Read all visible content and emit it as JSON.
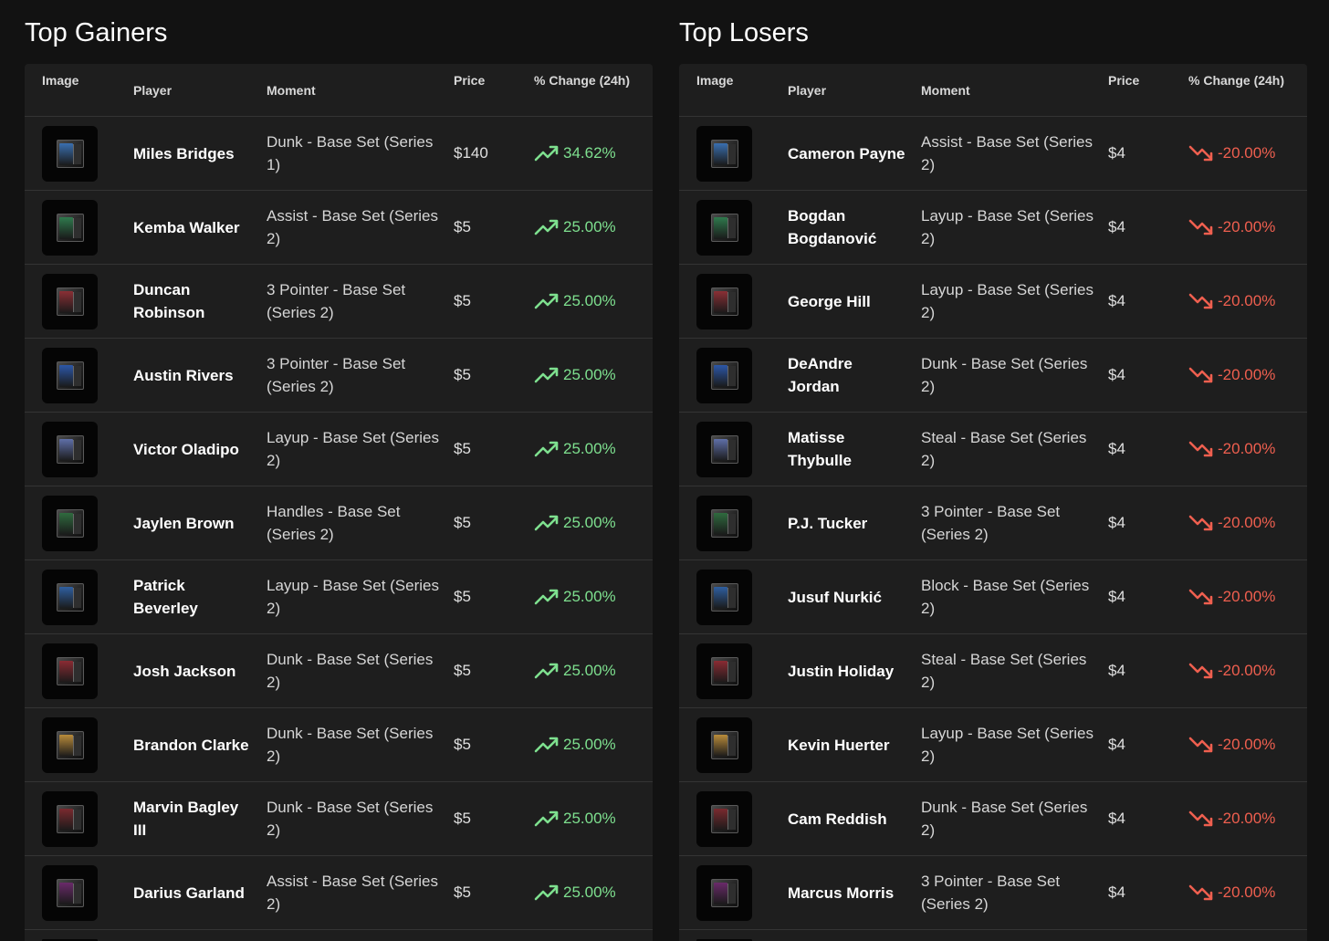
{
  "gainers": {
    "title": "Top Gainers",
    "headers": {
      "image": "Image",
      "player": "Player",
      "moment": "Moment",
      "price": "Price",
      "change": "% Change (24h)"
    },
    "rows": [
      {
        "player": "Miles Bridges",
        "moment": "Dunk - Base Set (Series 1)",
        "price": "$140",
        "change": "34.62%"
      },
      {
        "player": "Kemba Walker",
        "moment": "Assist - Base Set (Series 2)",
        "price": "$5",
        "change": "25.00%"
      },
      {
        "player": "Duncan Robinson",
        "moment": "3 Pointer - Base Set (Series 2)",
        "price": "$5",
        "change": "25.00%"
      },
      {
        "player": "Austin Rivers",
        "moment": "3 Pointer - Base Set (Series 2)",
        "price": "$5",
        "change": "25.00%"
      },
      {
        "player": "Victor Oladipo",
        "moment": "Layup - Base Set (Series 2)",
        "price": "$5",
        "change": "25.00%"
      },
      {
        "player": "Jaylen Brown",
        "moment": "Handles - Base Set (Series 2)",
        "price": "$5",
        "change": "25.00%"
      },
      {
        "player": "Patrick Beverley",
        "moment": "Layup - Base Set (Series 2)",
        "price": "$5",
        "change": "25.00%"
      },
      {
        "player": "Josh Jackson",
        "moment": "Dunk - Base Set (Series 2)",
        "price": "$5",
        "change": "25.00%"
      },
      {
        "player": "Brandon Clarke",
        "moment": "Dunk - Base Set (Series 2)",
        "price": "$5",
        "change": "25.00%"
      },
      {
        "player": "Marvin Bagley III",
        "moment": "Dunk - Base Set (Series 2)",
        "price": "$5",
        "change": "25.00%"
      },
      {
        "player": "Darius Garland",
        "moment": "Assist - Base Set (Series 2)",
        "price": "$5",
        "change": "25.00%"
      }
    ]
  },
  "losers": {
    "title": "Top Losers",
    "headers": {
      "image": "Image",
      "player": "Player",
      "moment": "Moment",
      "price": "Price",
      "change": "% Change (24h)"
    },
    "rows": [
      {
        "player": "Cameron Payne",
        "moment": "Assist - Base Set (Series 2)",
        "price": "$4",
        "change": "-20.00%"
      },
      {
        "player": "Bogdan Bogdanović",
        "moment": "Layup - Base Set (Series 2)",
        "price": "$4",
        "change": "-20.00%"
      },
      {
        "player": "George Hill",
        "moment": "Layup - Base Set (Series 2)",
        "price": "$4",
        "change": "-20.00%"
      },
      {
        "player": "DeAndre Jordan",
        "moment": "Dunk - Base Set (Series 2)",
        "price": "$4",
        "change": "-20.00%"
      },
      {
        "player": "Matisse Thybulle",
        "moment": "Steal - Base Set (Series 2)",
        "price": "$4",
        "change": "-20.00%"
      },
      {
        "player": "P.J. Tucker",
        "moment": "3 Pointer - Base Set (Series 2)",
        "price": "$4",
        "change": "-20.00%"
      },
      {
        "player": "Jusuf Nurkić",
        "moment": "Block - Base Set (Series 2)",
        "price": "$4",
        "change": "-20.00%"
      },
      {
        "player": "Justin Holiday",
        "moment": "Steal - Base Set (Series 2)",
        "price": "$4",
        "change": "-20.00%"
      },
      {
        "player": "Kevin Huerter",
        "moment": "Layup - Base Set (Series 2)",
        "price": "$4",
        "change": "-20.00%"
      },
      {
        "player": "Cam Reddish",
        "moment": "Dunk - Base Set (Series 2)",
        "price": "$4",
        "change": "-20.00%"
      },
      {
        "player": "Marcus Morris",
        "moment": "3 Pointer - Base Set (Series 2)",
        "price": "$4",
        "change": "-20.00%"
      }
    ]
  },
  "colors": {
    "up": "#7ee08f",
    "down": "#ef5f4f",
    "background": "#121212",
    "table": "#1e1e1e"
  },
  "icons": {
    "up": "trending-up-icon",
    "down": "trending-down-icon"
  }
}
